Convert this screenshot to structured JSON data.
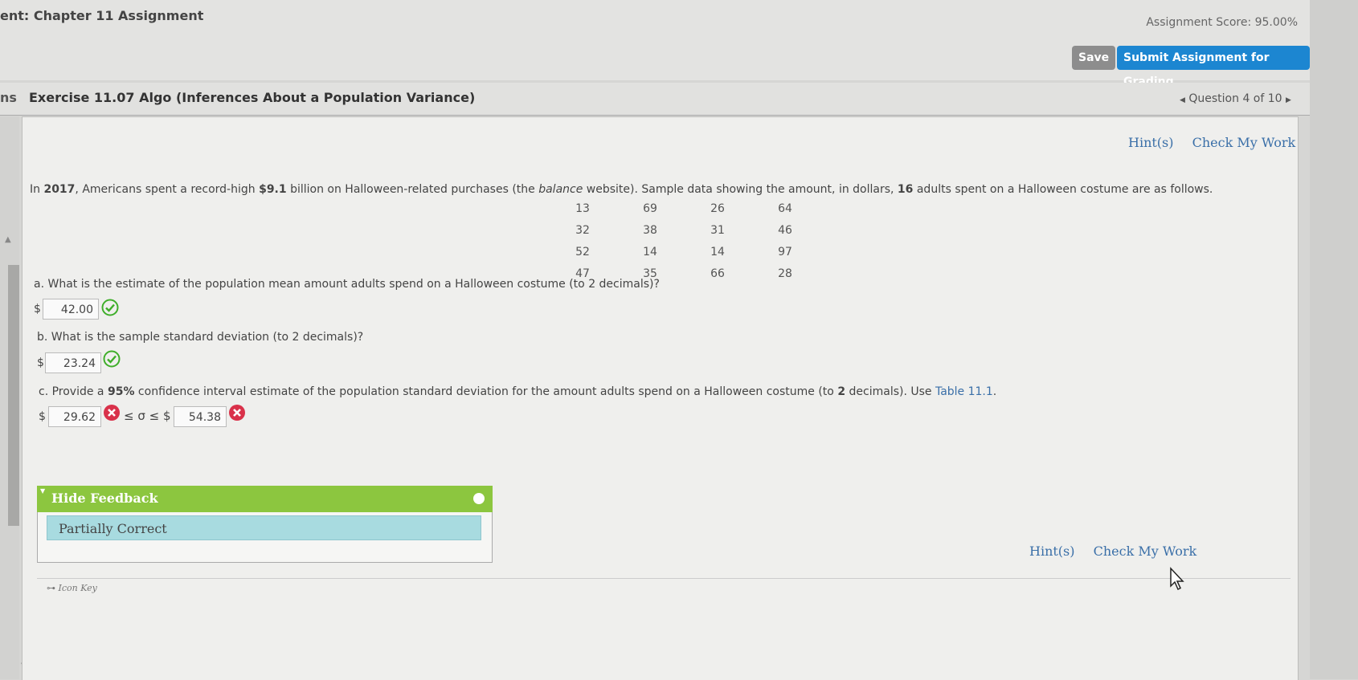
{
  "header": {
    "assignment_title": "ent: Chapter 11 Assignment",
    "score": "Assignment Score: 95.00%",
    "save_label": "Save",
    "submit_label": "Submit Assignment for Grading"
  },
  "exercise": {
    "left_label": "ns",
    "title": "Exercise 11.07 Algo (Inferences About a Population Variance)",
    "question_nav": "Question 4 of 10"
  },
  "hints": {
    "hint_label": "Hint(s)",
    "check_label": "Check My Work"
  },
  "problem": {
    "intro_pre": "In ",
    "intro_year": "2017",
    "intro_mid1": ", Americans spent a record-high ",
    "intro_amount": "$9.1",
    "intro_mid2": " billion on Halloween-related purchases (the ",
    "intro_source": "balance",
    "intro_mid3": " website). Sample data showing the amount, in dollars, ",
    "intro_n": "16",
    "intro_post": " adults spent on a Halloween costume are as follows.",
    "data": [
      [
        "13",
        "69",
        "26",
        "64"
      ],
      [
        "32",
        "38",
        "31",
        "46"
      ],
      [
        "52",
        "14",
        "14",
        "97"
      ],
      [
        "47",
        "35",
        "66",
        "28"
      ]
    ]
  },
  "questions": {
    "a": {
      "text": "a. What is the estimate of the population mean amount adults spend on a Halloween costume (to 2 decimals)?",
      "currency": "$",
      "answer": "42.00",
      "status": "correct"
    },
    "b": {
      "text": "b. What is the sample standard deviation (to 2 decimals)?",
      "currency": "$",
      "answer": "23.24",
      "status": "correct"
    },
    "c": {
      "text_pre": "c. Provide a ",
      "text_pct": "95%",
      "text_mid": " confidence interval estimate of the population standard deviation for the amount adults spend on a Halloween costume (to ",
      "text_dec": "2",
      "text_post": " decimals). Use ",
      "table_link": "Table 11.1",
      "text_end": ".",
      "currency": "$",
      "lower": "29.62",
      "upper": "54.38",
      "between": "≤ σ ≤ $",
      "status": "incorrect"
    }
  },
  "feedback": {
    "title": "Hide Feedback",
    "message": "Partially Correct"
  },
  "footer": {
    "icon_key": "Icon Key"
  },
  "colors": {
    "correct": "#3fae2a",
    "incorrect": "#d9314a",
    "feedback_green": "#8cc63f",
    "feedback_blue": "#a8dbe0",
    "link_blue": "#3a6fa8"
  }
}
